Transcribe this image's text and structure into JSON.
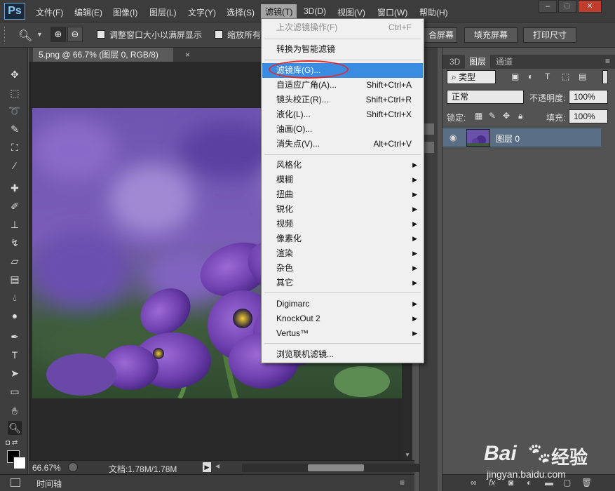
{
  "app": {
    "logo": "Ps"
  },
  "menubar": {
    "items": [
      "文件(F)",
      "编辑(E)",
      "图像(I)",
      "图层(L)",
      "文字(Y)",
      "选择(S)",
      "滤镜(T)",
      "3D(D)",
      "视图(V)",
      "窗口(W)",
      "帮助(H)"
    ],
    "active_index": 6,
    "window_controls": [
      "–",
      "□",
      "✕"
    ]
  },
  "options_bar": {
    "checkbox1_label": "调整窗口大小以满屏显示",
    "checkbox2_label": "缩放所有",
    "buttons": [
      "合屏幕",
      "填充屏幕",
      "打印尺寸"
    ]
  },
  "document": {
    "tab_title": "5.png @ 66.7% (图层 0, RGB/8)",
    "tab_close": "×"
  },
  "status": {
    "zoom": "66.67%",
    "doc_info": "文档:1.78M/1.78M",
    "timeline": "时间轴"
  },
  "layers_panel": {
    "tabs": [
      "3D",
      "图层",
      "通道"
    ],
    "active_tab": 1,
    "filter_kind": "类型",
    "blend_mode": "正常",
    "opacity_label": "不透明度:",
    "opacity_value": "100%",
    "lock_label": "锁定:",
    "fill_label": "填充:",
    "fill_value": "100%",
    "layer_name": "图层 0"
  },
  "filter_menu": {
    "groups": [
      [
        {
          "label": "上次滤镜操作(F)",
          "shortcut": "Ctrl+F",
          "disabled": true
        },
        {
          "label": "转换为智能滤镜",
          "shortcut": ""
        }
      ],
      [
        {
          "label": "滤镜库(G)...",
          "shortcut": "",
          "highlight": true
        },
        {
          "label": "自适应广角(A)...",
          "shortcut": "Shift+Ctrl+A"
        },
        {
          "label": "镜头校正(R)...",
          "shortcut": "Shift+Ctrl+R"
        },
        {
          "label": "液化(L)...",
          "shortcut": "Shift+Ctrl+X"
        },
        {
          "label": "油画(O)...",
          "shortcut": ""
        },
        {
          "label": "消失点(V)...",
          "shortcut": "Alt+Ctrl+V"
        }
      ],
      [
        {
          "label": "风格化",
          "submenu": true
        },
        {
          "label": "模糊",
          "submenu": true
        },
        {
          "label": "扭曲",
          "submenu": true
        },
        {
          "label": "锐化",
          "submenu": true
        },
        {
          "label": "视频",
          "submenu": true
        },
        {
          "label": "像素化",
          "submenu": true
        },
        {
          "label": "渲染",
          "submenu": true
        },
        {
          "label": "杂色",
          "submenu": true
        },
        {
          "label": "其它",
          "submenu": true
        }
      ],
      [
        {
          "label": "Digimarc",
          "submenu": true
        },
        {
          "label": "KnockOut 2",
          "submenu": true
        },
        {
          "label": "Vertus™",
          "submenu": true
        }
      ],
      [
        {
          "label": "浏览联机滤镜...",
          "shortcut": ""
        }
      ]
    ]
  },
  "watermark": {
    "brand": "Bai",
    "brand2": "经验",
    "url": "jingyan.baidu.com"
  },
  "colors": {
    "highlight": "#3a8ce3",
    "circle": "#e02c2c",
    "menubar": "#3c3c3c",
    "panel": "#535353"
  }
}
